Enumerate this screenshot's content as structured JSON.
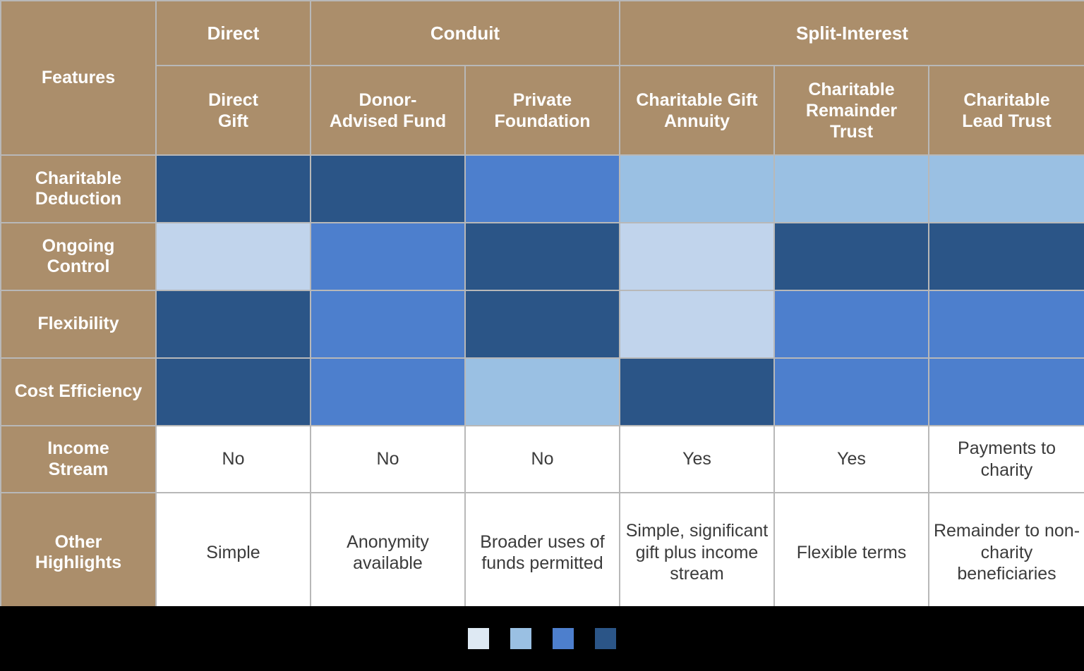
{
  "table": {
    "corner_label": "Features",
    "group_headers": [
      {
        "label": "Direct",
        "span": 1
      },
      {
        "label": "Conduit",
        "span": 2
      },
      {
        "label": "Split-Interest",
        "span": 3
      }
    ],
    "column_headers": [
      "Direct\nGift",
      "Donor-\nAdvised Fund",
      "Private\nFoundation",
      "Charitable Gift\nAnnuity",
      "Charitable\nRemainder\nTrust",
      "Charitable\nLead Trust"
    ],
    "heat_rows": [
      {
        "label": "Charitable\nDeduction",
        "levels": [
          4,
          4,
          3,
          2,
          2,
          2
        ]
      },
      {
        "label": "Ongoing\nControl",
        "levels": [
          1,
          3,
          4,
          1,
          4,
          4
        ]
      },
      {
        "label": "Flexibility",
        "levels": [
          4,
          3,
          4,
          1,
          3,
          3
        ]
      },
      {
        "label": "Cost Efficiency",
        "levels": [
          4,
          3,
          2,
          4,
          3,
          3
        ]
      }
    ],
    "text_rows": [
      {
        "label": "Income\nStream",
        "values": [
          "No",
          "No",
          "No",
          "Yes",
          "Yes",
          "Payments to charity"
        ]
      },
      {
        "label": "Other\nHighlights",
        "values": [
          "Simple",
          "Anonymity available",
          "Broader uses of funds permitted",
          "Simple, significant\ngift plus income\nstream",
          "Flexible terms",
          "Remainder to non-charity beneficiaries"
        ]
      }
    ]
  },
  "legend": {
    "swatches": [
      {
        "name": "level-1-lightest",
        "color": "#dee9f3"
      },
      {
        "name": "level-2-light",
        "color": "#9ac0e3"
      },
      {
        "name": "level-3-medium",
        "color": "#4d7fcd"
      },
      {
        "name": "level-4-darkest",
        "color": "#2b5587"
      }
    ]
  },
  "colors": {
    "header_brown": "#ab8e6b",
    "grid_line": "#b8b8b8",
    "cell_text": "#3b3b3b",
    "header_text": "#ffffff",
    "background": "#000000"
  }
}
